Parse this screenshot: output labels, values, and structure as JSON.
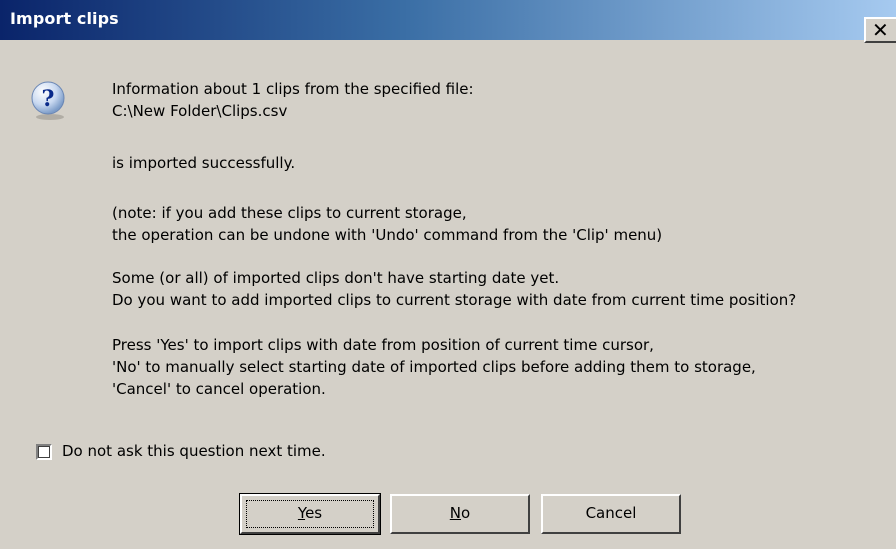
{
  "window": {
    "title": "Import clips",
    "close_glyph": "✕"
  },
  "icon": {
    "name": "question-icon",
    "glyph": "?"
  },
  "message": {
    "lines": [
      "Information about 1 clips from the specified file:",
      "C:\\New Folder\\Clips.csv",
      "is imported successfully.",
      "(note: if you add these clips to current storage,",
      "the operation can be undone with 'Undo' command from the 'Clip' menu)",
      "Some (or all) of imported clips don't have starting date yet.",
      "Do you want to add imported clips to current storage with date from current time position?",
      "Press 'Yes' to import clips with date from position of current time cursor,",
      "'No' to manually select starting date of imported clips before adding them to storage,",
      "'Cancel' to cancel operation."
    ]
  },
  "checkbox": {
    "label": "Do not ask this question next time.",
    "checked": false
  },
  "buttons": {
    "yes": {
      "mnemonic": "Y",
      "rest": "es"
    },
    "no": {
      "mnemonic": "N",
      "rest": "o"
    },
    "cancel": {
      "label": "Cancel"
    }
  },
  "colors": {
    "title_gradient_start": "#0a246a",
    "title_gradient_end": "#a6caf0",
    "dialog_bg": "#d4d0c8"
  }
}
